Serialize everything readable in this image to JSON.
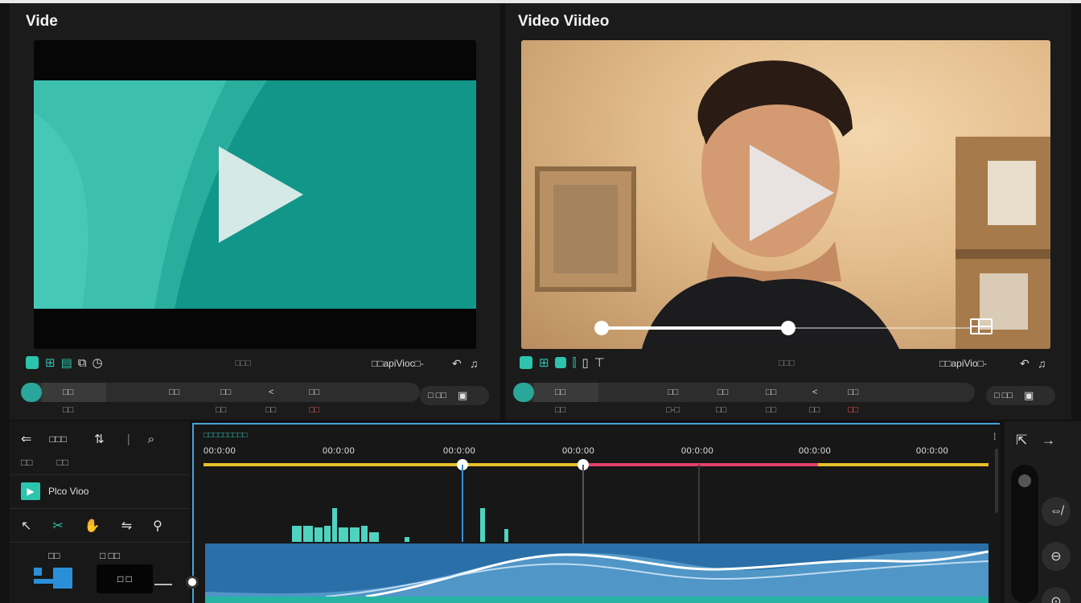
{
  "panels": {
    "left": {
      "title": "Vide",
      "toolbar_icons": [
        "square-filled-icon",
        "grid-icon",
        "list-icon",
        "copy-icon",
        "clock-icon"
      ],
      "toolbar_center": "□□□",
      "toolbar_right": "□□apiVioc□-",
      "controls": {
        "btn1": "□□",
        "btn2": "□□",
        "btn3": "<",
        "btn4": "□□",
        "btn5": "□□",
        "sub1": "□□",
        "sub2": "□□",
        "sub3": "□□",
        "sub4_red": "□□",
        "fullscreen_label": "□ □□"
      }
    },
    "right": {
      "title": "Video Viideo",
      "toolbar_center": "□□□",
      "toolbar_right": "□□apiVio□-",
      "controls": {
        "btn1": "□□",
        "btn2": "□□",
        "btn3": "□□",
        "btn4": "□□",
        "btn5": "<",
        "btn6": "□□",
        "sub1": "□□",
        "sub2": "□-□",
        "sub3": "□□",
        "sub4": "□□",
        "sub5": "□□",
        "sub6_red": "□□",
        "fullscreen_label": "□ □□"
      },
      "scrub_progress": 0.5
    }
  },
  "sidebar": {
    "row1_label": "□□□",
    "row2_a": "□□",
    "row2_b": "□□",
    "clip_label": "Plco Vioo",
    "row4_label": "□□",
    "row5_label": "□ □□",
    "thumb_label": "□ □"
  },
  "timeline": {
    "header_label": "□□□□□□□□□",
    "times": [
      "00:0:00",
      "00:0:00",
      "00:0:00",
      "00:0:00",
      "00:0:00",
      "00:0:00",
      "00:0:00"
    ]
  },
  "colors": {
    "accent_teal": "#2cc4ad",
    "timeline_yellow": "#e7c02c",
    "timeline_red": "#e5406b",
    "clip_blue": "#2a6fa8"
  }
}
